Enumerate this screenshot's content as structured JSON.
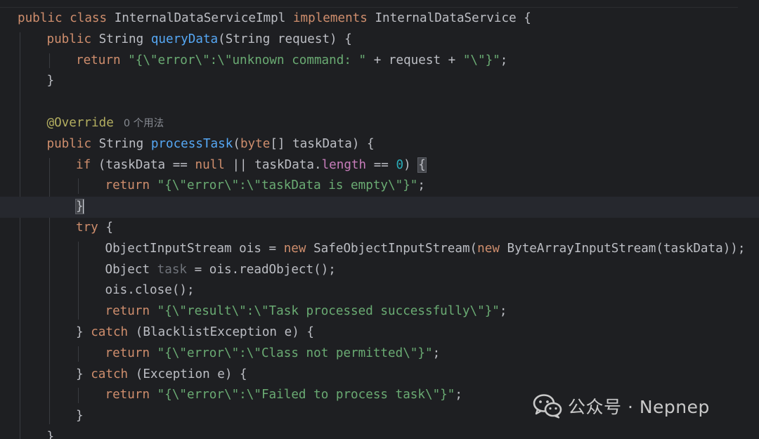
{
  "editor": {
    "lines": [
      {
        "indent": 0,
        "tokens": [
          {
            "t": "public class ",
            "c": "kw"
          },
          {
            "t": "InternalDataServiceImpl ",
            "c": "plain"
          },
          {
            "t": "implements ",
            "c": "kw"
          },
          {
            "t": "InternalDataService {",
            "c": "plain"
          }
        ]
      },
      {
        "indent": 1,
        "tokens": [
          {
            "t": "public ",
            "c": "kw"
          },
          {
            "t": "String ",
            "c": "plain"
          },
          {
            "t": "queryData",
            "c": "fn"
          },
          {
            "t": "(String request) {",
            "c": "plain"
          }
        ]
      },
      {
        "indent": 2,
        "tokens": [
          {
            "t": "return ",
            "c": "kw"
          },
          {
            "t": "\"{\\\"error\\\":\\\"unknown command: \"",
            "c": "str"
          },
          {
            "t": " + request + ",
            "c": "plain"
          },
          {
            "t": "\"\\\"}\"",
            "c": "str"
          },
          {
            "t": ";",
            "c": "plain"
          }
        ]
      },
      {
        "indent": 1,
        "tokens": [
          {
            "t": "}",
            "c": "plain"
          }
        ]
      },
      {
        "indent": 0,
        "tokens": []
      },
      {
        "indent": 1,
        "tokens": [
          {
            "t": "@Override",
            "c": "ann"
          }
        ],
        "inlay": "0 个用法"
      },
      {
        "indent": 1,
        "tokens": [
          {
            "t": "public ",
            "c": "kw"
          },
          {
            "t": "String ",
            "c": "plain"
          },
          {
            "t": "processTask",
            "c": "fn"
          },
          {
            "t": "(",
            "c": "plain"
          },
          {
            "t": "byte",
            "c": "kw"
          },
          {
            "t": "[] taskData) {",
            "c": "plain"
          }
        ]
      },
      {
        "indent": 2,
        "tokens": [
          {
            "t": "if ",
            "c": "kw"
          },
          {
            "t": "(taskData == ",
            "c": "plain"
          },
          {
            "t": "null",
            "c": "kw"
          },
          {
            "t": " || taskData.",
            "c": "plain"
          },
          {
            "t": "length",
            "c": "fld"
          },
          {
            "t": " == ",
            "c": "plain"
          },
          {
            "t": "0",
            "c": "num"
          },
          {
            "t": ") ",
            "c": "plain"
          },
          {
            "t": "{",
            "c": "bracehl"
          }
        ]
      },
      {
        "indent": 3,
        "tokens": [
          {
            "t": "return ",
            "c": "kw"
          },
          {
            "t": "\"{\\\"error\\\":\\\"taskData is empty\\\"}\"",
            "c": "str"
          },
          {
            "t": ";",
            "c": "plain"
          }
        ]
      },
      {
        "indent": 2,
        "tokens": [
          {
            "t": "}",
            "c": "bracehl"
          }
        ],
        "current": true,
        "caret": true
      },
      {
        "indent": 2,
        "tokens": [
          {
            "t": "try ",
            "c": "kw"
          },
          {
            "t": "{",
            "c": "plain"
          }
        ]
      },
      {
        "indent": 3,
        "tokens": [
          {
            "t": "ObjectInputStream ois = ",
            "c": "plain"
          },
          {
            "t": "new ",
            "c": "kw"
          },
          {
            "t": "SafeObjectInputStream(",
            "c": "plain"
          },
          {
            "t": "new ",
            "c": "kw"
          },
          {
            "t": "ByteArrayInputStream(taskData));",
            "c": "plain"
          }
        ]
      },
      {
        "indent": 3,
        "tokens": [
          {
            "t": "Object ",
            "c": "plain"
          },
          {
            "t": "task",
            "c": "unused"
          },
          {
            "t": " = ois.readObject();",
            "c": "plain"
          }
        ]
      },
      {
        "indent": 3,
        "tokens": [
          {
            "t": "ois.close();",
            "c": "plain"
          }
        ]
      },
      {
        "indent": 3,
        "tokens": [
          {
            "t": "return ",
            "c": "kw"
          },
          {
            "t": "\"{\\\"result\\\":\\\"Task processed successfully\\\"}\"",
            "c": "str"
          },
          {
            "t": ";",
            "c": "plain"
          }
        ]
      },
      {
        "indent": 2,
        "tokens": [
          {
            "t": "} ",
            "c": "plain"
          },
          {
            "t": "catch ",
            "c": "kw"
          },
          {
            "t": "(BlacklistException e) {",
            "c": "plain"
          }
        ]
      },
      {
        "indent": 3,
        "tokens": [
          {
            "t": "return ",
            "c": "kw"
          },
          {
            "t": "\"{\\\"error\\\":\\\"Class not permitted\\\"}\"",
            "c": "str"
          },
          {
            "t": ";",
            "c": "plain"
          }
        ]
      },
      {
        "indent": 2,
        "tokens": [
          {
            "t": "} ",
            "c": "plain"
          },
          {
            "t": "catch ",
            "c": "kw"
          },
          {
            "t": "(Exception e) {",
            "c": "plain"
          }
        ]
      },
      {
        "indent": 3,
        "tokens": [
          {
            "t": "return ",
            "c": "kw"
          },
          {
            "t": "\"{\\\"error\\\":\\\"Failed to process task\\\"}\"",
            "c": "str"
          },
          {
            "t": ";",
            "c": "plain"
          }
        ]
      },
      {
        "indent": 2,
        "tokens": [
          {
            "t": "}",
            "c": "plain"
          }
        ]
      },
      {
        "indent": 1,
        "tokens": [
          {
            "t": "}",
            "c": "plain"
          }
        ]
      }
    ]
  },
  "watermark": {
    "text": "公众号 · Nepnep",
    "icon": "wechat-icon"
  }
}
